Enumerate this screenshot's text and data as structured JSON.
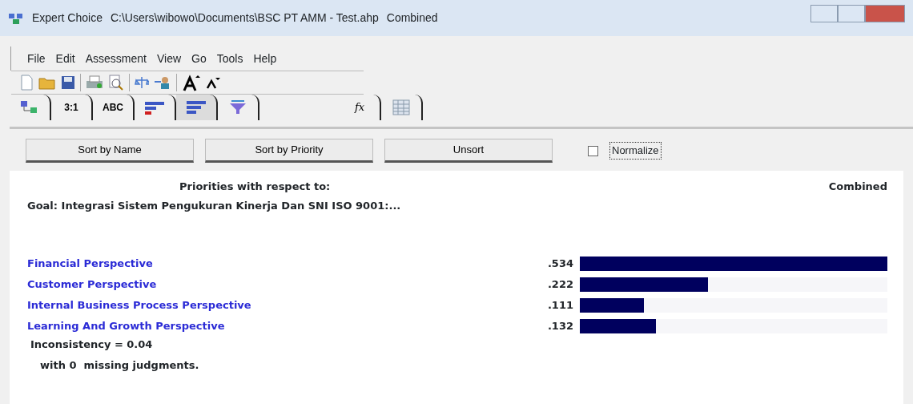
{
  "window": {
    "app": "Expert Choice",
    "path": "C:\\Users\\wibowo\\Documents\\BSC PT AMM - Test.ahp",
    "mode": "Combined"
  },
  "menu": [
    "File",
    "Edit",
    "Assessment",
    "View",
    "Go",
    "Tools",
    "Help"
  ],
  "tabs": [
    {
      "kind": "icon",
      "selected": false
    },
    {
      "kind": "text",
      "label": "3:1",
      "selected": false
    },
    {
      "kind": "text",
      "label": "ABC",
      "selected": false
    },
    {
      "kind": "icon",
      "selected": false
    },
    {
      "kind": "icon",
      "selected": true
    },
    {
      "kind": "icon",
      "selected": false
    },
    {
      "kind": "formula",
      "label": "fx",
      "selected": false
    },
    {
      "kind": "icon",
      "selected": false
    }
  ],
  "sort_buttons": [
    "Sort by Name",
    "Sort by Priority",
    "Unsort"
  ],
  "normalize": {
    "label": "Normalize",
    "checked": false
  },
  "report": {
    "heading": "Priorities with respect to:",
    "mode": "Combined",
    "goal": "Goal: Integrasi Sistem Pengukuran Kinerja Dan SNI ISO 9001:...",
    "rows": [
      {
        "name": "Financial Perspective",
        "value": ".534",
        "level": 1.0
      },
      {
        "name": "Customer Perspective",
        "value": ".222",
        "level": 0.416
      },
      {
        "name": "Internal Business Process Perspective",
        "value": ".111",
        "level": 0.208
      },
      {
        "name": "Learning And Growth Perspective",
        "value": ".132",
        "level": 0.247
      }
    ],
    "inconsistency": "Inconsistency = 0.04",
    "missing": "with 0  missing judgments."
  }
}
